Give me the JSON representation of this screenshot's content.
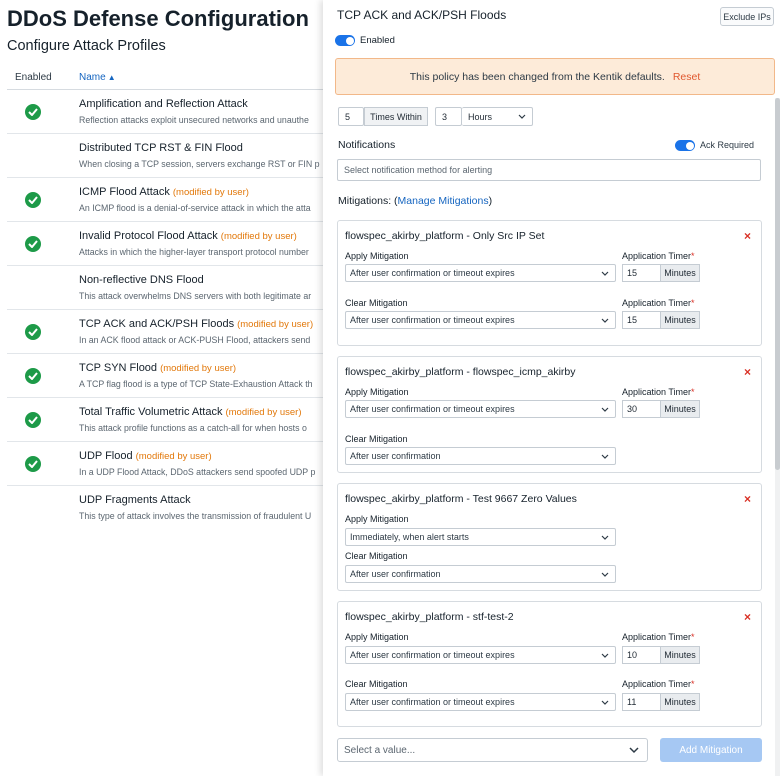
{
  "page": {
    "title": "DDoS Defense Configuration",
    "subtitle": "Configure Attack Profiles"
  },
  "profiles_table": {
    "columns": {
      "enabled": "Enabled",
      "name": "Name"
    },
    "rows": [
      {
        "name": "Amplification and Reflection Attack",
        "modified": "",
        "enabled": true,
        "description": "Reflection attacks exploit unsecured networks and unauthe"
      },
      {
        "name": "Distributed TCP RST & FIN Flood",
        "modified": "",
        "enabled": false,
        "description": "When closing a TCP session, servers exchange RST or FIN p"
      },
      {
        "name": "ICMP Flood Attack",
        "modified": "(modified by user)",
        "enabled": true,
        "description": "An ICMP flood is a denial-of-service attack in which the atta"
      },
      {
        "name": "Invalid Protocol Flood Attack",
        "modified": "(modified by user)",
        "enabled": true,
        "description": "Attacks in which the higher-layer transport protocol number"
      },
      {
        "name": "Non-reflective DNS Flood",
        "modified": "",
        "enabled": false,
        "description": "This attack overwhelms DNS servers with both legitimate ar"
      },
      {
        "name": "TCP ACK and ACK/PSH Floods",
        "modified": "(modified by user)",
        "enabled": true,
        "description": "In an ACK flood attack or ACK-PUSH Flood, attackers send"
      },
      {
        "name": "TCP SYN Flood",
        "modified": "(modified by user)",
        "enabled": true,
        "description": "A TCP flag flood is a type of TCP State-Exhaustion Attack th"
      },
      {
        "name": "Total Traffic Volumetric Attack",
        "modified": "(modified by user)",
        "enabled": true,
        "description": "This attack profile functions as a catch-all for when hosts o"
      },
      {
        "name": "UDP Flood",
        "modified": "(modified by user)",
        "enabled": true,
        "description": "In a UDP Flood Attack, DDoS attackers send spoofed UDP p"
      },
      {
        "name": "UDP Fragments Attack",
        "modified": "",
        "enabled": false,
        "description": "This type of attack involves the transmission of fraudulent U"
      }
    ]
  },
  "drawer": {
    "title": "TCP ACK and ACK/PSH Floods",
    "exclude_ips_label": "Exclude IPs",
    "enabled_label": "Enabled",
    "banner_text": "This policy has been changed from the Kentik defaults.",
    "banner_reset": "Reset",
    "times": "5",
    "times_within_label": "Times Within",
    "hours_value": "3",
    "hours_unit": "Hours",
    "notifications_label": "Notifications",
    "ack_required_label": "Ack Required",
    "notification_placeholder": "Select notification method for alerting",
    "mitigations_label": "Mitigations: (",
    "manage_mitigations_label": "Manage Mitigations",
    "mitigations_close_paren": ")",
    "apply_label": "Apply Mitigation",
    "clear_label": "Clear Mitigation",
    "timer_label": "Application Timer",
    "timer_required": "*",
    "minutes_label": "Minutes",
    "cards": [
      {
        "title": "flowspec_akirby_platform - Only Src IP Set",
        "apply": "After user confirmation or timeout expires",
        "apply_timer": "15",
        "clear": "After user confirmation or timeout expires",
        "clear_timer": "15"
      },
      {
        "title": "flowspec_akirby_platform - flowspec_icmp_akirby",
        "apply": "After user confirmation or timeout expires",
        "apply_timer": "30",
        "clear": "After user confirmation"
      },
      {
        "title": "flowspec_akirby_platform - Test 9667 Zero Values",
        "apply": "Immediately, when alert starts",
        "clear": "After user confirmation"
      },
      {
        "title": "flowspec_akirby_platform - stf-test-2",
        "apply": "After user confirmation or timeout expires",
        "apply_timer": "10",
        "clear": "After user confirmation or timeout expires",
        "clear_timer": "11"
      }
    ],
    "add_select_placeholder": "Select a value...",
    "add_mitigation_label": "Add Mitigation"
  },
  "colors": {
    "accent": "#1a73e8",
    "check_green": "#1d9a48",
    "modified_orange": "#e2780a",
    "banner_bg": "#fdebd9",
    "remove_red": "#d93025"
  }
}
